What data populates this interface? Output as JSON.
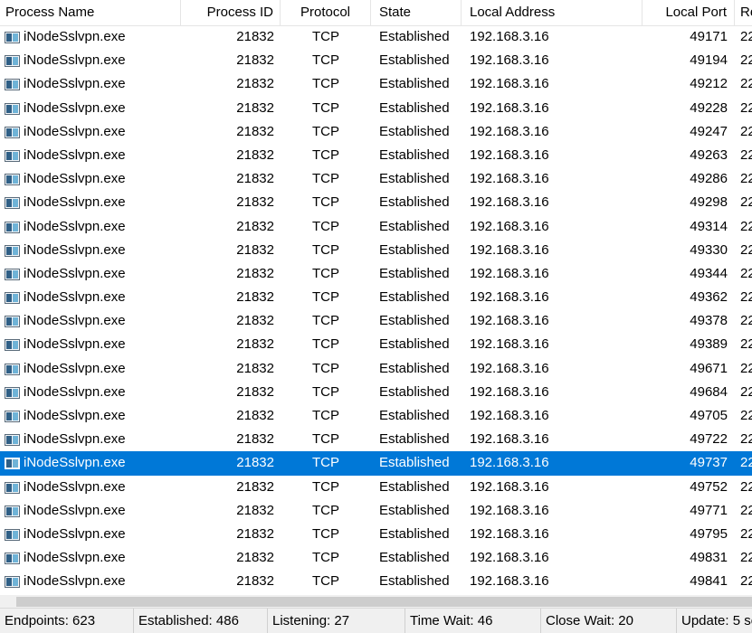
{
  "columns": {
    "process_name": "Process Name",
    "process_id": "Process ID",
    "protocol": "Protocol",
    "state": "State",
    "local_address": "Local Address",
    "local_port": "Local Port",
    "remote": "Re"
  },
  "rows": [
    {
      "name": "iNodeSslvpn.exe",
      "pid": "21832",
      "protocol": "TCP",
      "state": "Established",
      "local_address": "192.168.3.16",
      "local_port": "49171",
      "remote": "22"
    },
    {
      "name": "iNodeSslvpn.exe",
      "pid": "21832",
      "protocol": "TCP",
      "state": "Established",
      "local_address": "192.168.3.16",
      "local_port": "49194",
      "remote": "22"
    },
    {
      "name": "iNodeSslvpn.exe",
      "pid": "21832",
      "protocol": "TCP",
      "state": "Established",
      "local_address": "192.168.3.16",
      "local_port": "49212",
      "remote": "22"
    },
    {
      "name": "iNodeSslvpn.exe",
      "pid": "21832",
      "protocol": "TCP",
      "state": "Established",
      "local_address": "192.168.3.16",
      "local_port": "49228",
      "remote": "22"
    },
    {
      "name": "iNodeSslvpn.exe",
      "pid": "21832",
      "protocol": "TCP",
      "state": "Established",
      "local_address": "192.168.3.16",
      "local_port": "49247",
      "remote": "22"
    },
    {
      "name": "iNodeSslvpn.exe",
      "pid": "21832",
      "protocol": "TCP",
      "state": "Established",
      "local_address": "192.168.3.16",
      "local_port": "49263",
      "remote": "22"
    },
    {
      "name": "iNodeSslvpn.exe",
      "pid": "21832",
      "protocol": "TCP",
      "state": "Established",
      "local_address": "192.168.3.16",
      "local_port": "49286",
      "remote": "22"
    },
    {
      "name": "iNodeSslvpn.exe",
      "pid": "21832",
      "protocol": "TCP",
      "state": "Established",
      "local_address": "192.168.3.16",
      "local_port": "49298",
      "remote": "22"
    },
    {
      "name": "iNodeSslvpn.exe",
      "pid": "21832",
      "protocol": "TCP",
      "state": "Established",
      "local_address": "192.168.3.16",
      "local_port": "49314",
      "remote": "22"
    },
    {
      "name": "iNodeSslvpn.exe",
      "pid": "21832",
      "protocol": "TCP",
      "state": "Established",
      "local_address": "192.168.3.16",
      "local_port": "49330",
      "remote": "22"
    },
    {
      "name": "iNodeSslvpn.exe",
      "pid": "21832",
      "protocol": "TCP",
      "state": "Established",
      "local_address": "192.168.3.16",
      "local_port": "49344",
      "remote": "22"
    },
    {
      "name": "iNodeSslvpn.exe",
      "pid": "21832",
      "protocol": "TCP",
      "state": "Established",
      "local_address": "192.168.3.16",
      "local_port": "49362",
      "remote": "22"
    },
    {
      "name": "iNodeSslvpn.exe",
      "pid": "21832",
      "protocol": "TCP",
      "state": "Established",
      "local_address": "192.168.3.16",
      "local_port": "49378",
      "remote": "22"
    },
    {
      "name": "iNodeSslvpn.exe",
      "pid": "21832",
      "protocol": "TCP",
      "state": "Established",
      "local_address": "192.168.3.16",
      "local_port": "49389",
      "remote": "22"
    },
    {
      "name": "iNodeSslvpn.exe",
      "pid": "21832",
      "protocol": "TCP",
      "state": "Established",
      "local_address": "192.168.3.16",
      "local_port": "49671",
      "remote": "22"
    },
    {
      "name": "iNodeSslvpn.exe",
      "pid": "21832",
      "protocol": "TCP",
      "state": "Established",
      "local_address": "192.168.3.16",
      "local_port": "49684",
      "remote": "22"
    },
    {
      "name": "iNodeSslvpn.exe",
      "pid": "21832",
      "protocol": "TCP",
      "state": "Established",
      "local_address": "192.168.3.16",
      "local_port": "49705",
      "remote": "22"
    },
    {
      "name": "iNodeSslvpn.exe",
      "pid": "21832",
      "protocol": "TCP",
      "state": "Established",
      "local_address": "192.168.3.16",
      "local_port": "49722",
      "remote": "22"
    },
    {
      "name": "iNodeSslvpn.exe",
      "pid": "21832",
      "protocol": "TCP",
      "state": "Established",
      "local_address": "192.168.3.16",
      "local_port": "49737",
      "remote": "22",
      "selected": true
    },
    {
      "name": "iNodeSslvpn.exe",
      "pid": "21832",
      "protocol": "TCP",
      "state": "Established",
      "local_address": "192.168.3.16",
      "local_port": "49752",
      "remote": "22"
    },
    {
      "name": "iNodeSslvpn.exe",
      "pid": "21832",
      "protocol": "TCP",
      "state": "Established",
      "local_address": "192.168.3.16",
      "local_port": "49771",
      "remote": "22"
    },
    {
      "name": "iNodeSslvpn.exe",
      "pid": "21832",
      "protocol": "TCP",
      "state": "Established",
      "local_address": "192.168.3.16",
      "local_port": "49795",
      "remote": "22"
    },
    {
      "name": "iNodeSslvpn.exe",
      "pid": "21832",
      "protocol": "TCP",
      "state": "Established",
      "local_address": "192.168.3.16",
      "local_port": "49831",
      "remote": "22"
    },
    {
      "name": "iNodeSslvpn.exe",
      "pid": "21832",
      "protocol": "TCP",
      "state": "Established",
      "local_address": "192.168.3.16",
      "local_port": "49841",
      "remote": "22"
    }
  ],
  "status": {
    "endpoints": "Endpoints: 623",
    "established": "Established: 486",
    "listening": "Listening: 27",
    "time_wait": "Time Wait: 46",
    "close_wait": "Close Wait: 20",
    "update": "Update: 5 se"
  },
  "colors": {
    "selection": "#0078d7",
    "statusbar_bg": "#f0f0f0"
  },
  "icons": {
    "process": "process-window-icon"
  }
}
